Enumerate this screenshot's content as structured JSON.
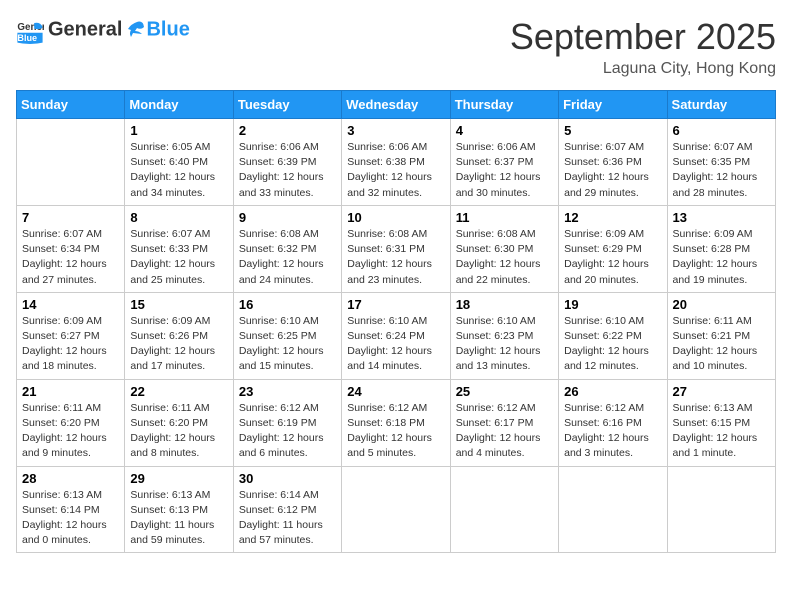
{
  "header": {
    "logo_general": "General",
    "logo_blue": "Blue",
    "month_title": "September 2025",
    "location": "Laguna City, Hong Kong"
  },
  "weekdays": [
    "Sunday",
    "Monday",
    "Tuesday",
    "Wednesday",
    "Thursday",
    "Friday",
    "Saturday"
  ],
  "weeks": [
    [
      {
        "day": "",
        "info": ""
      },
      {
        "day": "1",
        "info": "Sunrise: 6:05 AM\nSunset: 6:40 PM\nDaylight: 12 hours\nand 34 minutes."
      },
      {
        "day": "2",
        "info": "Sunrise: 6:06 AM\nSunset: 6:39 PM\nDaylight: 12 hours\nand 33 minutes."
      },
      {
        "day": "3",
        "info": "Sunrise: 6:06 AM\nSunset: 6:38 PM\nDaylight: 12 hours\nand 32 minutes."
      },
      {
        "day": "4",
        "info": "Sunrise: 6:06 AM\nSunset: 6:37 PM\nDaylight: 12 hours\nand 30 minutes."
      },
      {
        "day": "5",
        "info": "Sunrise: 6:07 AM\nSunset: 6:36 PM\nDaylight: 12 hours\nand 29 minutes."
      },
      {
        "day": "6",
        "info": "Sunrise: 6:07 AM\nSunset: 6:35 PM\nDaylight: 12 hours\nand 28 minutes."
      }
    ],
    [
      {
        "day": "7",
        "info": "Sunrise: 6:07 AM\nSunset: 6:34 PM\nDaylight: 12 hours\nand 27 minutes."
      },
      {
        "day": "8",
        "info": "Sunrise: 6:07 AM\nSunset: 6:33 PM\nDaylight: 12 hours\nand 25 minutes."
      },
      {
        "day": "9",
        "info": "Sunrise: 6:08 AM\nSunset: 6:32 PM\nDaylight: 12 hours\nand 24 minutes."
      },
      {
        "day": "10",
        "info": "Sunrise: 6:08 AM\nSunset: 6:31 PM\nDaylight: 12 hours\nand 23 minutes."
      },
      {
        "day": "11",
        "info": "Sunrise: 6:08 AM\nSunset: 6:30 PM\nDaylight: 12 hours\nand 22 minutes."
      },
      {
        "day": "12",
        "info": "Sunrise: 6:09 AM\nSunset: 6:29 PM\nDaylight: 12 hours\nand 20 minutes."
      },
      {
        "day": "13",
        "info": "Sunrise: 6:09 AM\nSunset: 6:28 PM\nDaylight: 12 hours\nand 19 minutes."
      }
    ],
    [
      {
        "day": "14",
        "info": "Sunrise: 6:09 AM\nSunset: 6:27 PM\nDaylight: 12 hours\nand 18 minutes."
      },
      {
        "day": "15",
        "info": "Sunrise: 6:09 AM\nSunset: 6:26 PM\nDaylight: 12 hours\nand 17 minutes."
      },
      {
        "day": "16",
        "info": "Sunrise: 6:10 AM\nSunset: 6:25 PM\nDaylight: 12 hours\nand 15 minutes."
      },
      {
        "day": "17",
        "info": "Sunrise: 6:10 AM\nSunset: 6:24 PM\nDaylight: 12 hours\nand 14 minutes."
      },
      {
        "day": "18",
        "info": "Sunrise: 6:10 AM\nSunset: 6:23 PM\nDaylight: 12 hours\nand 13 minutes."
      },
      {
        "day": "19",
        "info": "Sunrise: 6:10 AM\nSunset: 6:22 PM\nDaylight: 12 hours\nand 12 minutes."
      },
      {
        "day": "20",
        "info": "Sunrise: 6:11 AM\nSunset: 6:21 PM\nDaylight: 12 hours\nand 10 minutes."
      }
    ],
    [
      {
        "day": "21",
        "info": "Sunrise: 6:11 AM\nSunset: 6:20 PM\nDaylight: 12 hours\nand 9 minutes."
      },
      {
        "day": "22",
        "info": "Sunrise: 6:11 AM\nSunset: 6:20 PM\nDaylight: 12 hours\nand 8 minutes."
      },
      {
        "day": "23",
        "info": "Sunrise: 6:12 AM\nSunset: 6:19 PM\nDaylight: 12 hours\nand 6 minutes."
      },
      {
        "day": "24",
        "info": "Sunrise: 6:12 AM\nSunset: 6:18 PM\nDaylight: 12 hours\nand 5 minutes."
      },
      {
        "day": "25",
        "info": "Sunrise: 6:12 AM\nSunset: 6:17 PM\nDaylight: 12 hours\nand 4 minutes."
      },
      {
        "day": "26",
        "info": "Sunrise: 6:12 AM\nSunset: 6:16 PM\nDaylight: 12 hours\nand 3 minutes."
      },
      {
        "day": "27",
        "info": "Sunrise: 6:13 AM\nSunset: 6:15 PM\nDaylight: 12 hours\nand 1 minute."
      }
    ],
    [
      {
        "day": "28",
        "info": "Sunrise: 6:13 AM\nSunset: 6:14 PM\nDaylight: 12 hours\nand 0 minutes."
      },
      {
        "day": "29",
        "info": "Sunrise: 6:13 AM\nSunset: 6:13 PM\nDaylight: 11 hours\nand 59 minutes."
      },
      {
        "day": "30",
        "info": "Sunrise: 6:14 AM\nSunset: 6:12 PM\nDaylight: 11 hours\nand 57 minutes."
      },
      {
        "day": "",
        "info": ""
      },
      {
        "day": "",
        "info": ""
      },
      {
        "day": "",
        "info": ""
      },
      {
        "day": "",
        "info": ""
      }
    ]
  ]
}
